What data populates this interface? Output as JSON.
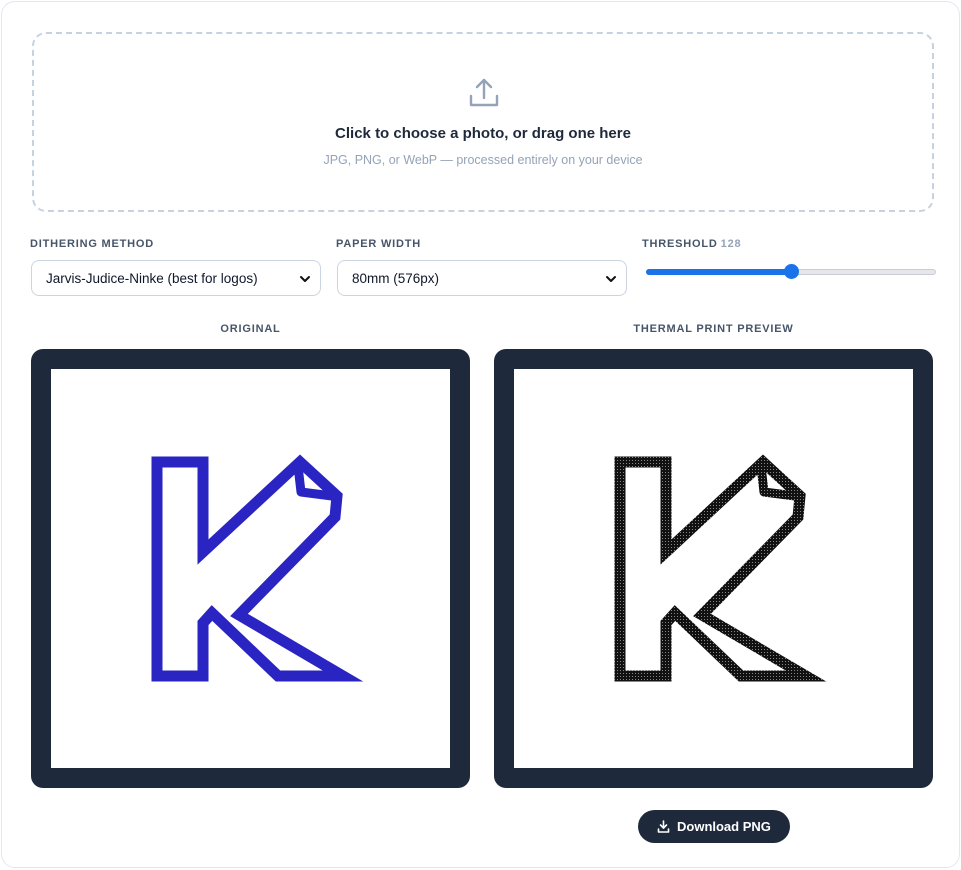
{
  "upload": {
    "title": "Click to choose a photo, or drag one here",
    "subtitle": "JPG, PNG, or WebP — processed entirely on your device",
    "icon": "upload-icon"
  },
  "controls": {
    "dithering": {
      "label": "DITHERING METHOD",
      "selected": "Jarvis-Judice-Ninke (best for logos)"
    },
    "paper_width": {
      "label": "PAPER WIDTH",
      "selected": "80mm (576px)"
    },
    "threshold": {
      "label": "THRESHOLD",
      "value": "128",
      "min": 0,
      "max": 255,
      "fraction": 0.5
    }
  },
  "previews": {
    "original_title": "ORIGINAL",
    "thermal_title": "THERMAL PRINT PREVIEW"
  },
  "download": {
    "label": "Download PNG",
    "icon": "download-icon"
  },
  "colors": {
    "accent": "#1a73e8",
    "frame": "#1e293b",
    "logo_original": "#2a25c2",
    "logo_thermal": "#111111"
  }
}
